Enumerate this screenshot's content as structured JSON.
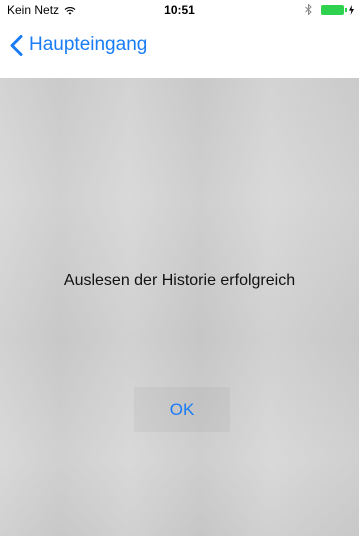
{
  "status_bar": {
    "carrier": "Kein Netz",
    "time": "10:51",
    "icons": [
      "wifi-icon",
      "bluetooth-icon",
      "battery-icon",
      "charging-icon"
    ],
    "battery_color": "#2fd24f"
  },
  "nav_bar": {
    "back_label": "Haupteingang",
    "back_icon": "chevron-left-icon",
    "accent_color": "#1a7cf5"
  },
  "dialog": {
    "message": "Auslesen der Historie erfolgreich",
    "ok_label": "OK"
  }
}
